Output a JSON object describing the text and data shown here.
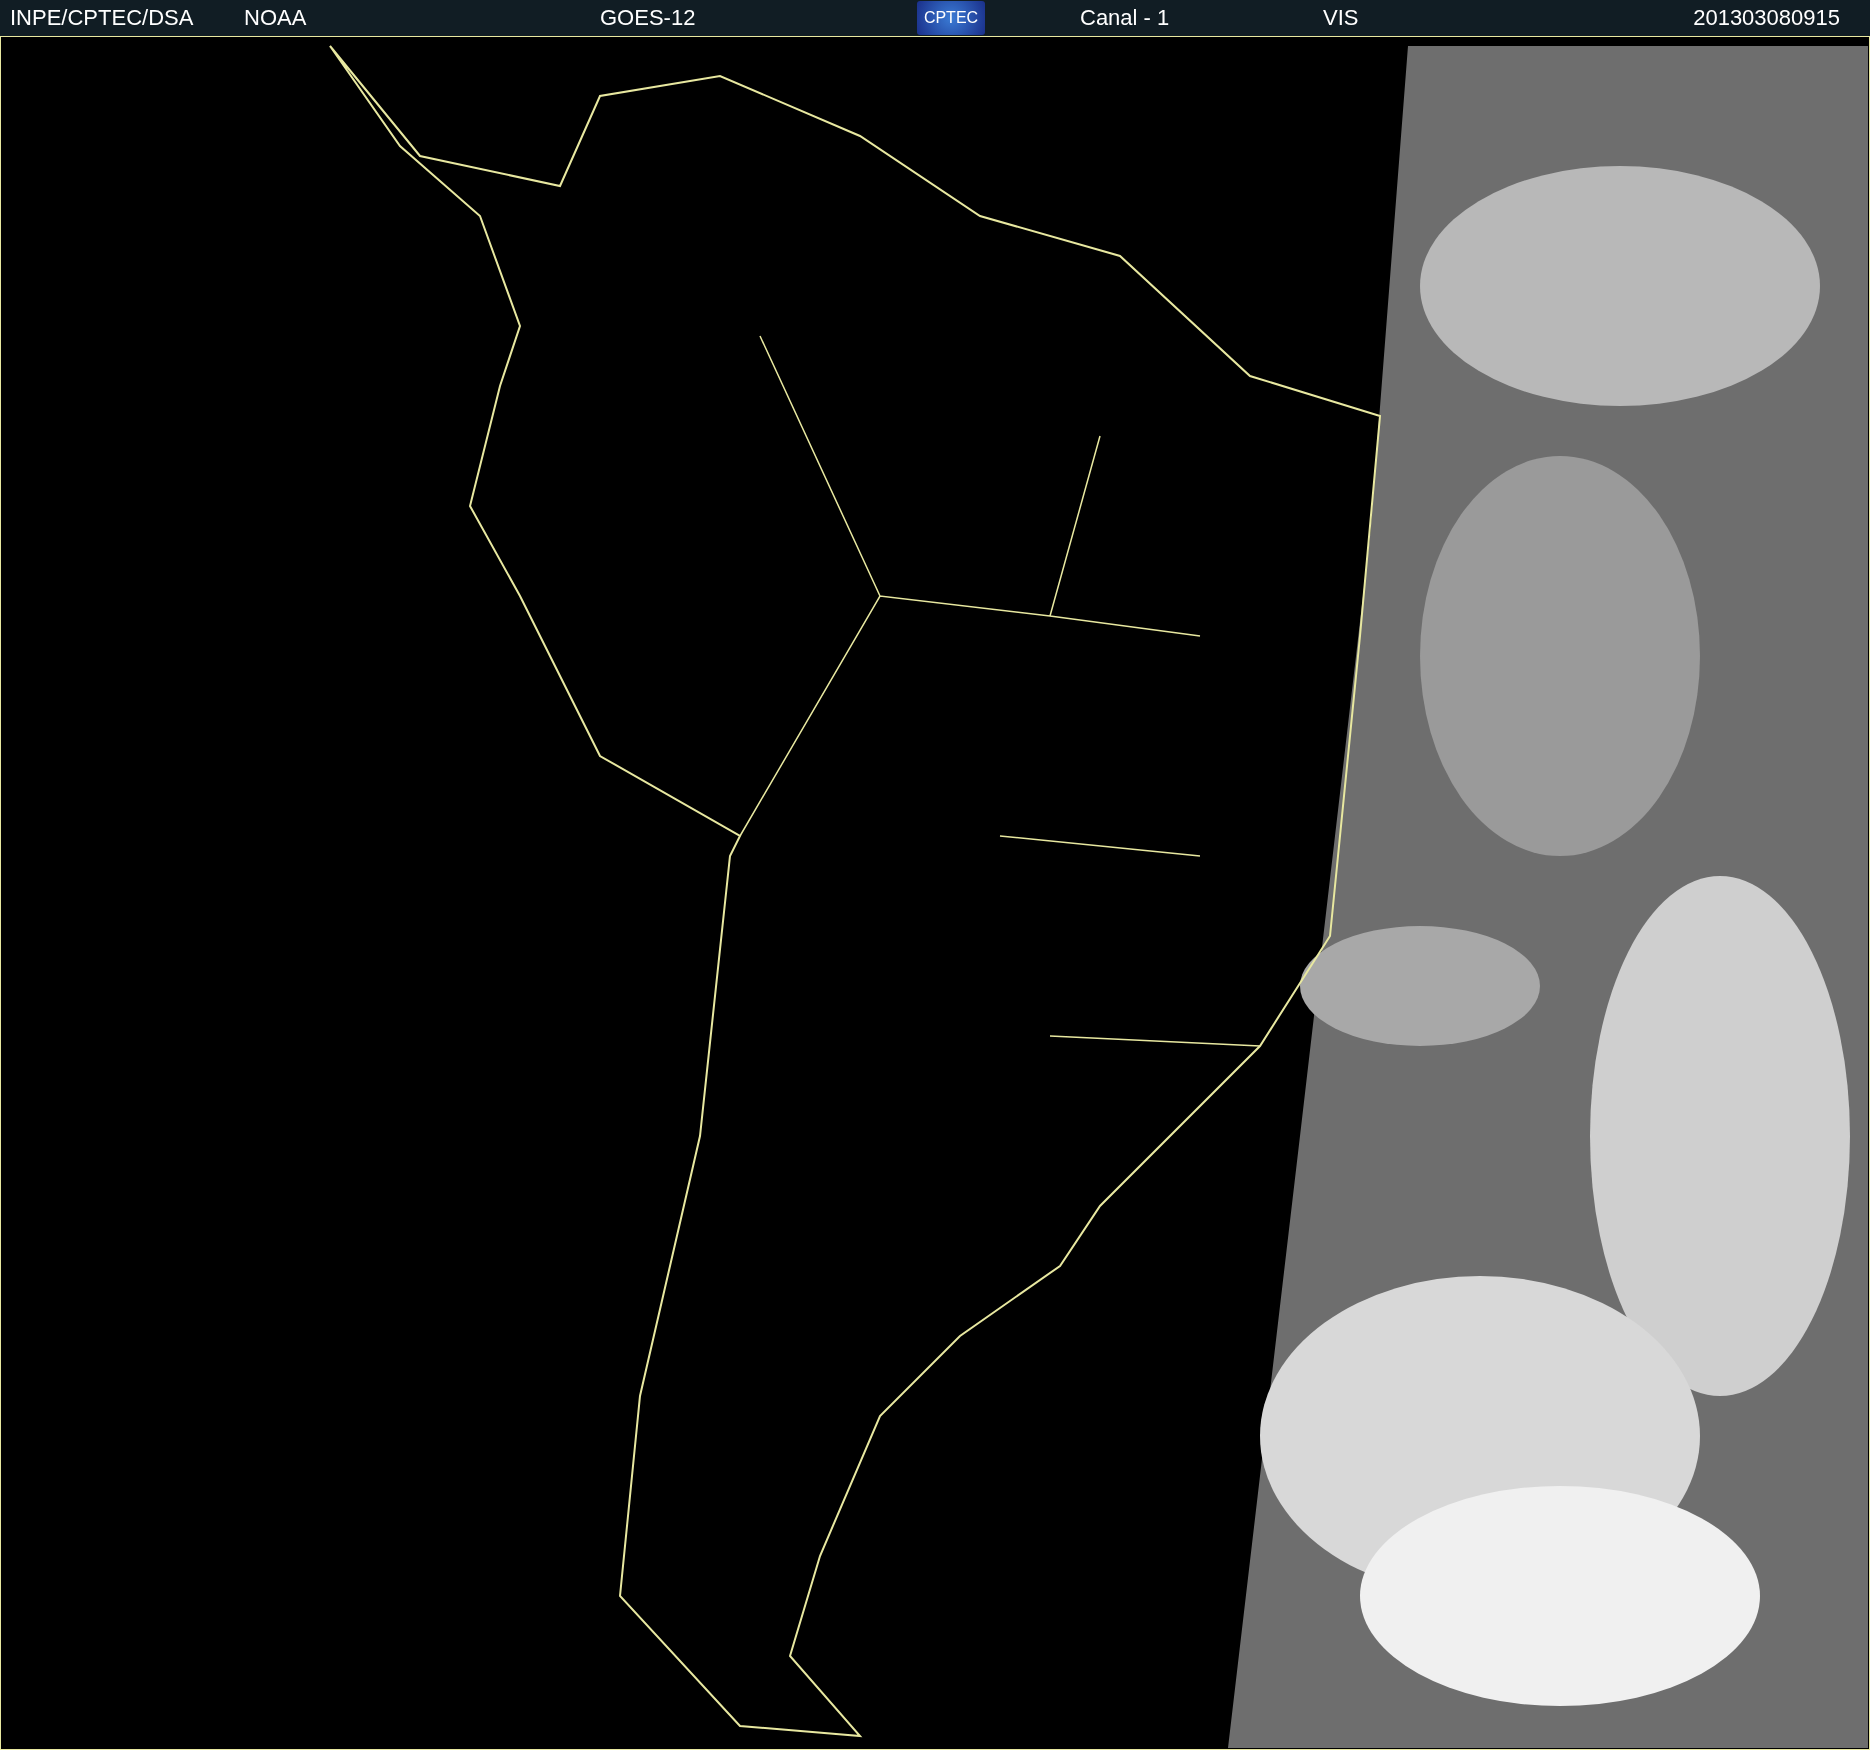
{
  "header": {
    "items": [
      {
        "kind": "text",
        "text": "INPE/CPTEC/DSA"
      },
      {
        "kind": "text",
        "text": "NOAA"
      },
      {
        "kind": "text",
        "text": "GOES-12"
      },
      {
        "kind": "logo",
        "text": "CPTEC"
      },
      {
        "kind": "text",
        "text": "Canal - 1"
      },
      {
        "kind": "text",
        "text": "VIS"
      },
      {
        "kind": "text",
        "text": "201303080915"
      }
    ]
  }
}
